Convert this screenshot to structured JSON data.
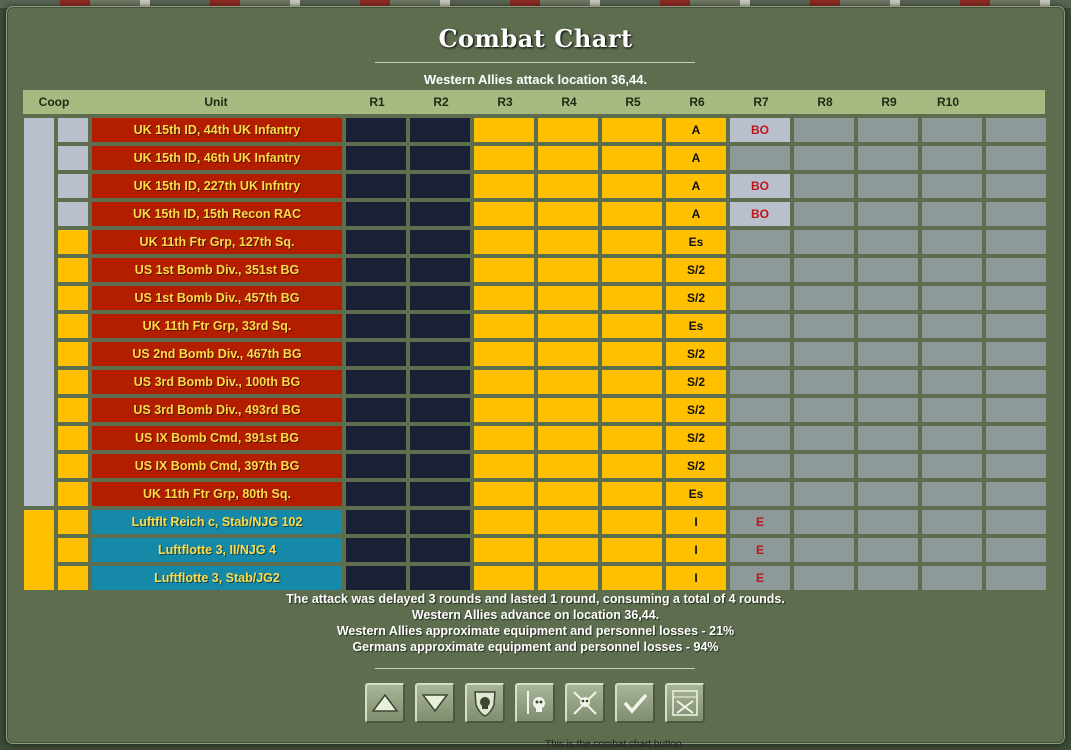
{
  "window": {
    "title": "Combat Chart",
    "subtitle": "Western Allies attack location 36,44."
  },
  "headers": {
    "coop": "Coop",
    "unit": "Unit",
    "rounds": [
      "R1",
      "R2",
      "R3",
      "R4",
      "R5",
      "R6",
      "R7",
      "R8",
      "R9",
      "R10"
    ]
  },
  "colors": {
    "dark_cell": "#1a2035",
    "yellow_cell": "#ffc000",
    "grey_cell": "#8e999a",
    "ally_unit": "#b31d00",
    "axis_unit": "#1789a8",
    "ally_coop": "#b9bfcc",
    "axis_coop": "#ffc000",
    "header": "#a6ba82"
  },
  "rows": [
    {
      "unit": "UK 15th ID, 44th UK Infantry",
      "side": "ally",
      "coop": "grey",
      "r6": "A",
      "r7": "BO",
      "r7_color": "yellow",
      "r8_10": "grey"
    },
    {
      "unit": "UK 15th ID, 46th UK Infantry",
      "side": "ally",
      "coop": "grey",
      "r6": "A",
      "r7": "",
      "r7_color": "grey"
    },
    {
      "unit": "UK 15th ID, 227th UK Infntry",
      "side": "ally",
      "coop": "grey",
      "r6": "A",
      "r7": "BO",
      "r7_color": "yellow"
    },
    {
      "unit": "UK 15th ID, 15th Recon RAC",
      "side": "ally",
      "coop": "grey",
      "r6": "A",
      "r7": "BO",
      "r7_color": "yellow"
    },
    {
      "unit": "UK 11th Ftr Grp, 127th Sq.",
      "side": "ally",
      "coop": "yellow",
      "r6": "Es",
      "r7": "",
      "r7_color": "grey"
    },
    {
      "unit": "US 1st Bomb Div., 351st BG",
      "side": "ally",
      "coop": "yellow",
      "r6": "S/2",
      "r7": "",
      "r7_color": "grey"
    },
    {
      "unit": "US 1st Bomb Div., 457th BG",
      "side": "ally",
      "coop": "yellow",
      "r6": "S/2",
      "r7": "",
      "r7_color": "grey"
    },
    {
      "unit": "UK 11th Ftr Grp, 33rd Sq.",
      "side": "ally",
      "coop": "yellow",
      "r6": "Es",
      "r7": "",
      "r7_color": "grey"
    },
    {
      "unit": "US 2nd Bomb Div., 467th BG",
      "side": "ally",
      "coop": "yellow",
      "r6": "S/2",
      "r7": "",
      "r7_color": "grey"
    },
    {
      "unit": "US 3rd Bomb Div., 100th BG",
      "side": "ally",
      "coop": "yellow",
      "r6": "S/2",
      "r7": "",
      "r7_color": "grey"
    },
    {
      "unit": "US 3rd Bomb Div., 493rd BG",
      "side": "ally",
      "coop": "yellow",
      "r6": "S/2",
      "r7": "",
      "r7_color": "grey"
    },
    {
      "unit": "US IX Bomb Cmd, 391st BG",
      "side": "ally",
      "coop": "yellow",
      "r6": "S/2",
      "r7": "",
      "r7_color": "grey"
    },
    {
      "unit": "US IX Bomb Cmd, 397th BG",
      "side": "ally",
      "coop": "yellow",
      "r6": "S/2",
      "r7": "",
      "r7_color": "grey"
    },
    {
      "unit": "UK 11th Ftr Grp, 80th Sq.",
      "side": "ally",
      "coop": "yellow",
      "r6": "Es",
      "r7": "",
      "r7_color": "grey"
    },
    {
      "unit": "Luftflt Reich c, Stab/NJG 102",
      "side": "axis",
      "coop": "yellow",
      "r6": "I",
      "r7": "E",
      "r7_color": "grey"
    },
    {
      "unit": "Luftflotte 3, II/NJG 4",
      "side": "axis",
      "coop": "yellow",
      "r6": "I",
      "r7": "E",
      "r7_color": "grey"
    },
    {
      "unit": "Luftflotte 3, Stab/JG2",
      "side": "axis",
      "coop": "yellow",
      "r6": "I",
      "r7": "E",
      "r7_color": "grey"
    }
  ],
  "summary": {
    "line1": "The attack was delayed  3  rounds and lasted  1  round, consuming a total of  4  rounds.",
    "line2": "Western Allies advance on location 36,44.",
    "line3": "Western Allies approximate equipment and personnel losses - 21%",
    "line4": "Germans approximate equipment and personnel losses - 94%"
  },
  "buttons": [
    {
      "icon": "triangle-up-icon"
    },
    {
      "icon": "triangle-down-icon"
    },
    {
      "icon": "shield-skull-icon"
    },
    {
      "icon": "sword-skull-icon"
    },
    {
      "icon": "crossed-swords-skull-icon"
    },
    {
      "icon": "checkmark-icon"
    },
    {
      "icon": "map-crossed-swords-icon"
    }
  ],
  "bottom_hint": "This is the combat chart button."
}
